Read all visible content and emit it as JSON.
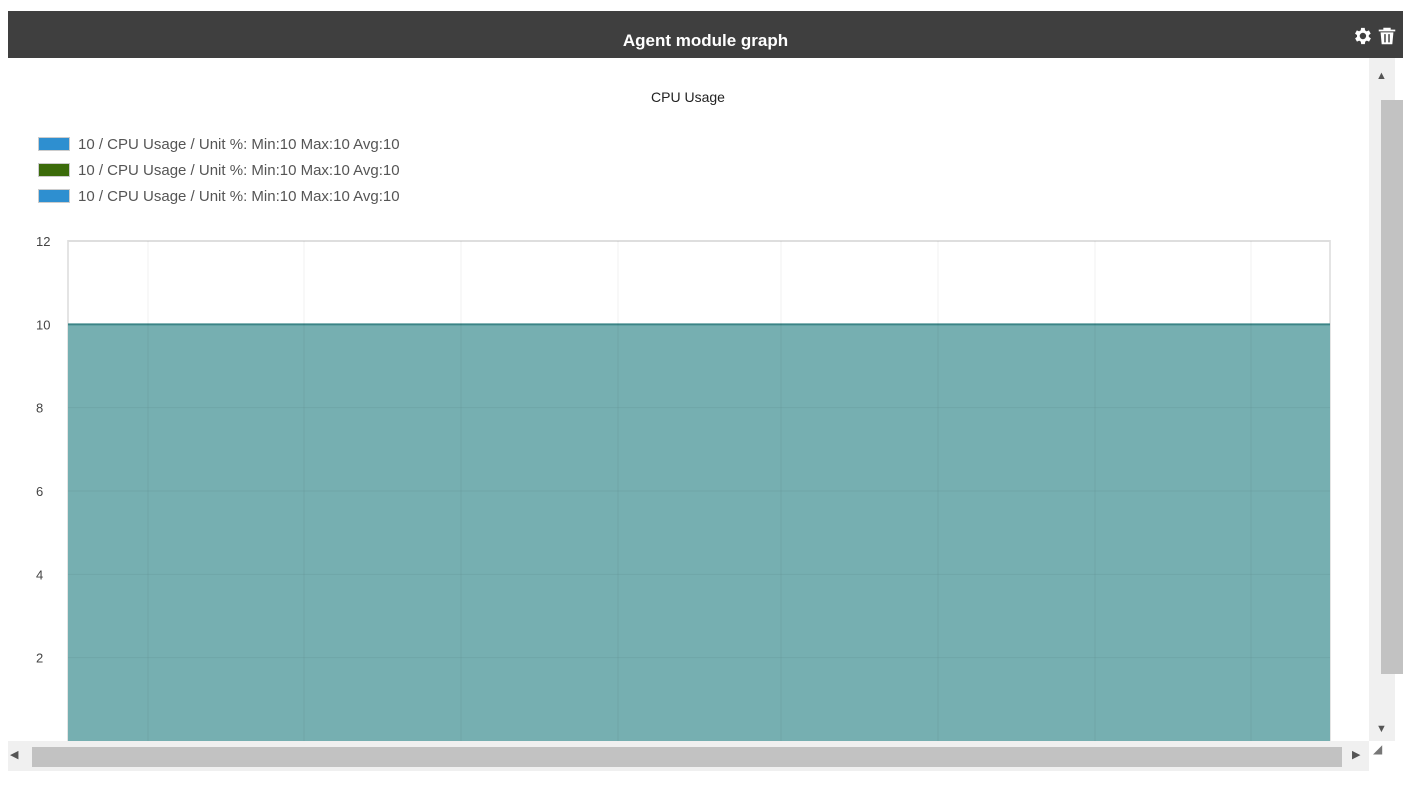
{
  "widget": {
    "title": "Agent module graph",
    "icons": [
      "gear-icon",
      "trash-icon"
    ]
  },
  "chart_data": {
    "type": "area",
    "title": "CPU Usage",
    "legend": [
      {
        "label": "10 / CPU Usage / Unit %: Min:10 Max:10 Avg:10",
        "color": "#2e8fd0"
      },
      {
        "label": "10 / CPU Usage / Unit %: Min:10 Max:10 Avg:10",
        "color": "#3b6b0a"
      },
      {
        "label": "10 / CPU Usage / Unit %: Min:10 Max:10 Avg:10",
        "color": "#2e8fd0"
      }
    ],
    "series": [
      {
        "values": [
          10,
          10,
          10,
          10,
          10,
          10,
          10,
          10,
          10
        ]
      }
    ],
    "fill_color": "#76afb1",
    "line_color": "#3f8a8c",
    "yticks": [
      2,
      4,
      6,
      8,
      10,
      12
    ],
    "ylim": [
      0,
      12
    ],
    "grid": true
  }
}
